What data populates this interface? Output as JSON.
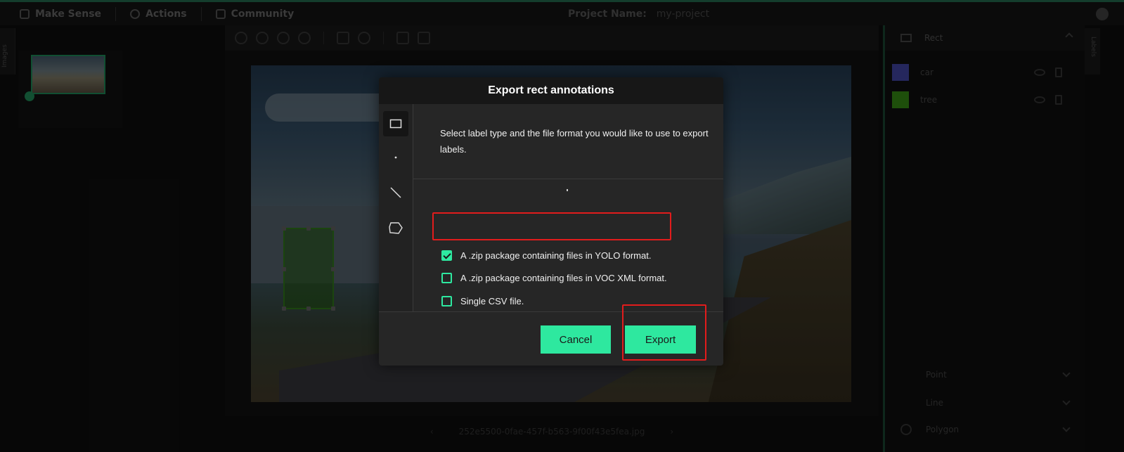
{
  "topbar": {
    "app_name": "Make Sense",
    "actions": "Actions",
    "community": "Community",
    "project_label": "Project Name:",
    "project_value": "my-project"
  },
  "left_panel": {
    "tab": "Images"
  },
  "right_panel": {
    "tab": "Labels",
    "rect_header": "Rect",
    "labels": [
      {
        "name": "car",
        "color": "#3a3c8f"
      },
      {
        "name": "tree",
        "color": "#2f7a12"
      }
    ],
    "sections": [
      "Point",
      "Line",
      "Polygon"
    ]
  },
  "file_name": "252e5500-0fae-457f-b563-9f00f43e5fea.jpg",
  "dialog": {
    "title": "Export rect annotations",
    "description": "Select label type and the file format you would like to use to export labels.",
    "options": [
      {
        "label": "A .zip package containing files in YOLO format.",
        "checked": true
      },
      {
        "label": "A .zip package containing files in VOC XML format.",
        "checked": false
      },
      {
        "label": "Single CSV file.",
        "checked": false
      }
    ],
    "cancel": "Cancel",
    "export": "Export"
  },
  "colors": {
    "accent": "#2ee89f",
    "highlight": "#e21c1c"
  }
}
